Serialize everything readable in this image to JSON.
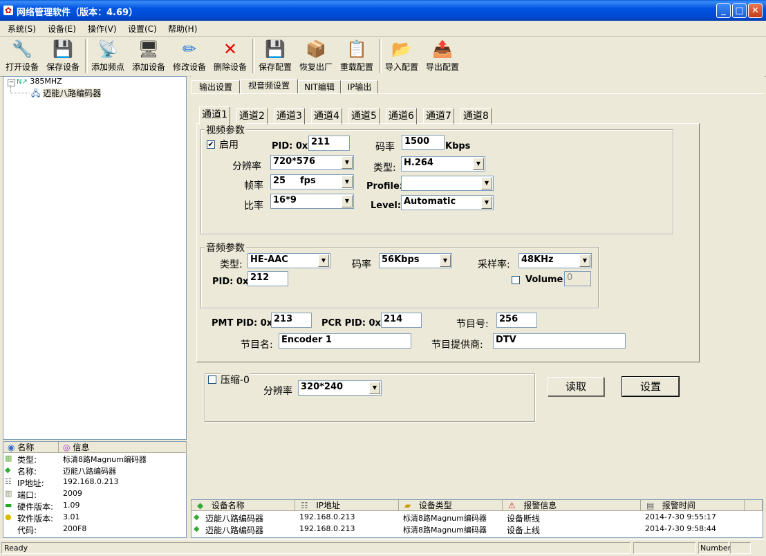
{
  "window": {
    "title": "网络管理软件（版本：4.69）",
    "minimize": "_",
    "maximize": "□",
    "close": "✕"
  },
  "menu": [
    "系统(S)",
    "设备(E)",
    "操作(V)",
    "设置(C)",
    "帮助(H)"
  ],
  "toolbar": [
    {
      "label": "打开设备",
      "icon": "🔧"
    },
    {
      "label": "保存设备",
      "icon": "💾"
    },
    {
      "label": "添加频点",
      "icon": "📡"
    },
    {
      "label": "添加设备",
      "icon": "🖥"
    },
    {
      "label": "修改设备",
      "icon": "✏"
    },
    {
      "label": "删除设备",
      "icon": "✕"
    },
    {
      "label": "保存配置",
      "icon": "💾"
    },
    {
      "label": "恢复出厂",
      "icon": "📦"
    },
    {
      "label": "重载配置",
      "icon": "📋"
    },
    {
      "label": "导入配置",
      "icon": "📂"
    },
    {
      "label": "导出配置",
      "icon": "📤"
    }
  ],
  "tree": {
    "root": "385MHZ",
    "child": "迈能八路编码器"
  },
  "info": {
    "headers": [
      "名称",
      "信息"
    ],
    "rows": [
      {
        "name": "类型:",
        "value": "标清8路Magnum编码器"
      },
      {
        "name": "名称:",
        "value": "迈能八路编码器"
      },
      {
        "name": "IP地址:",
        "value": "192.168.0.213"
      },
      {
        "name": "端口:",
        "value": "2009"
      },
      {
        "name": "硬件版本:",
        "value": "1.09"
      },
      {
        "name": "软件版本:",
        "value": "3.01"
      },
      {
        "name": "代码:",
        "value": "200F8"
      }
    ]
  },
  "main_tabs": [
    "输出设置",
    "视音频设置",
    "NIT编辑",
    "IP输出"
  ],
  "channel_tabs": [
    "通道1",
    "通道2",
    "通道3",
    "通道4",
    "通道5",
    "通道6",
    "通道7",
    "通道8"
  ],
  "video": {
    "group_title": "视频参数",
    "enable_label": "启用",
    "enabled": true,
    "pid_label": "PID: 0x",
    "pid": "211",
    "bitrate_label": "码率",
    "bitrate": "1500",
    "bitrate_unit": "Kbps",
    "resolution_label": "分辨率",
    "resolution": "720*576",
    "type_label": "类型:",
    "type": "H.264",
    "framerate_label": "帧率",
    "framerate": "25",
    "framerate_unit": "fps",
    "profile_label": "Profile:",
    "profile": "",
    "ratio_label": "比率",
    "ratio": "16*9",
    "level_label": "Level:",
    "level": "Automatic"
  },
  "audio": {
    "group_title": "音频参数",
    "type_label": "类型:",
    "type": "HE-AAC",
    "bitrate_label": "码率",
    "bitrate": "56Kbps",
    "samplerate_label": "采样率:",
    "samplerate": "48KHz",
    "pid_label": "PID: 0x",
    "pid": "212",
    "volume_label": "Volume",
    "volume": "0"
  },
  "program": {
    "pmt_label": "PMT PID: 0x",
    "pmt": "213",
    "pcr_label": "PCR PID: 0x",
    "pcr": "214",
    "num_label": "节目号:",
    "num": "256",
    "name_label": "节目名:",
    "name": "Encoder 1",
    "provider_label": "节目提供商:",
    "provider": "DTV"
  },
  "compress": {
    "label": "压缩-0",
    "res_label": "分辨率",
    "res": "320*240"
  },
  "buttons": {
    "read": "读取",
    "set": "设置"
  },
  "alarm": {
    "headers": [
      "设备名称",
      "IP地址",
      "设备类型",
      "报警信息",
      "报警时间"
    ],
    "rows": [
      [
        "迈能八路编码器",
        "192.168.0.213",
        "标清8路Magnum编码器",
        "设备断线",
        "2014-7-30  9:55:17"
      ],
      [
        "迈能八路编码器",
        "192.168.0.213",
        "标清8路Magnum编码器",
        "设备上线",
        "2014-7-30  9:58:44"
      ]
    ]
  },
  "status": {
    "left": "Ready",
    "num": "Number"
  }
}
